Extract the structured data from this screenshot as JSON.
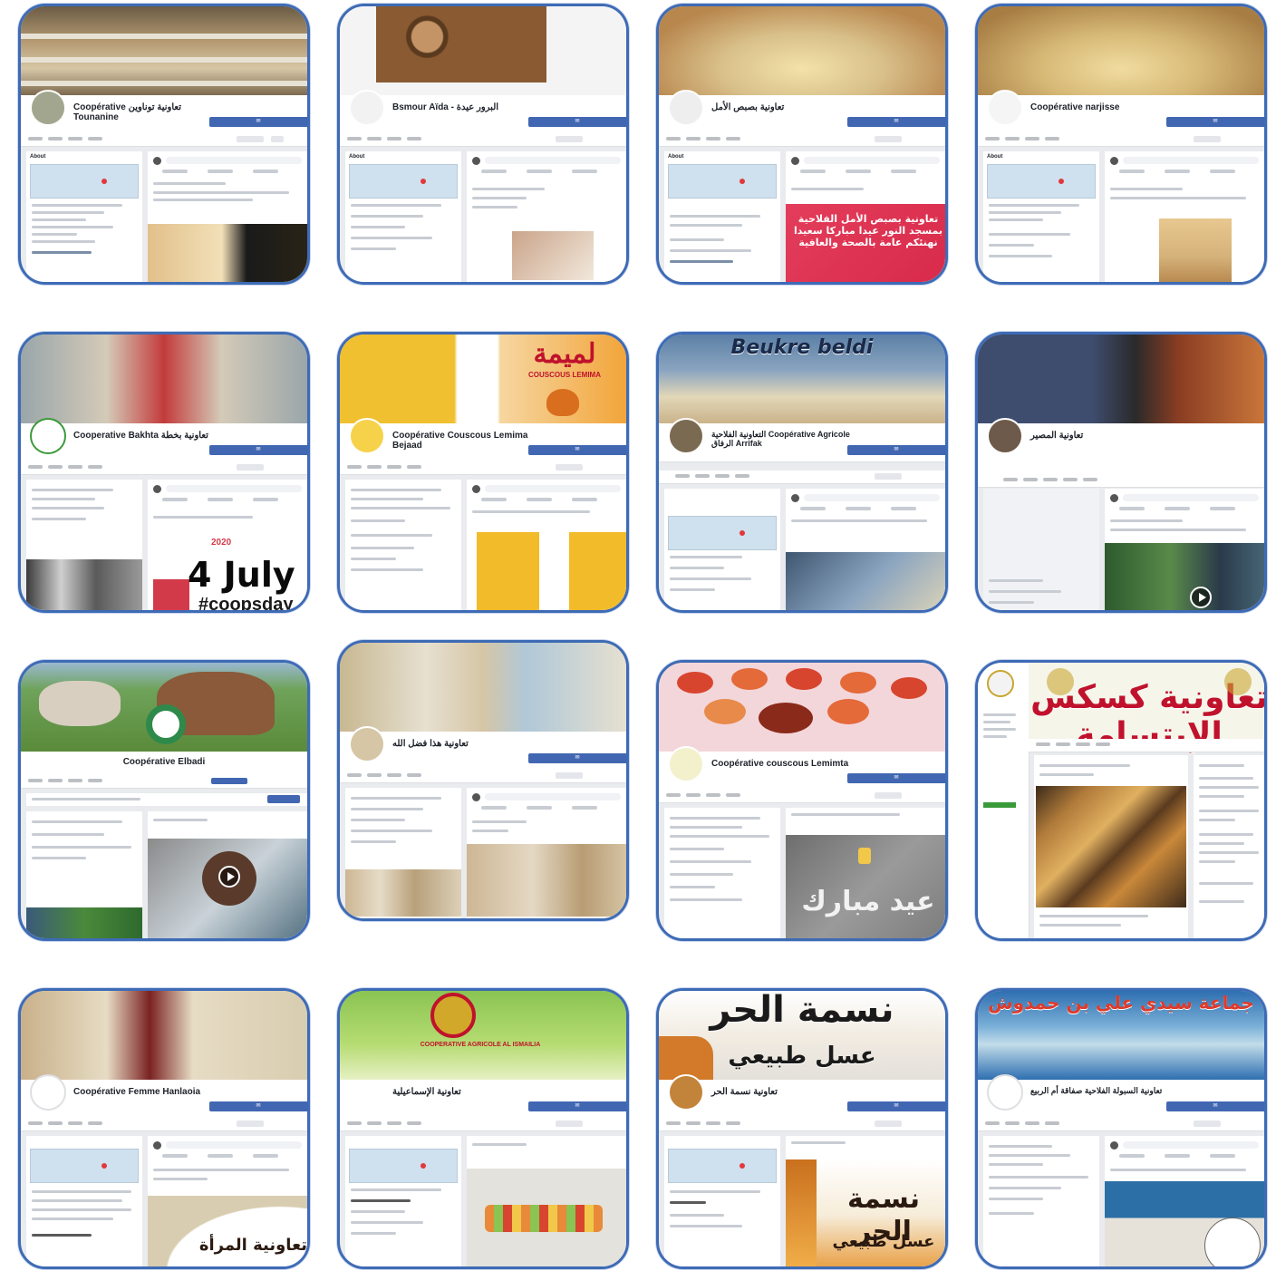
{
  "cards": [
    {
      "id": "c1",
      "name": "Coopérative تعاونية توناوين Tounanine",
      "sub": "",
      "button": "",
      "cover": "#b59a73",
      "cover2": "#7d6a4f",
      "avatar": "#a2a68e",
      "post": "#e2c08a",
      "caption": ""
    },
    {
      "id": "c2",
      "name": "Bsmour Aïda - البرور عيدة",
      "sub": "",
      "button": "",
      "cover": "#8a5a32",
      "cover2": "#c49466",
      "avatar": "#f2f2f2",
      "post": "#caa48a",
      "caption": ""
    },
    {
      "id": "c3",
      "name": "تعاونية بصبص الأمل",
      "sub": "",
      "button": "",
      "cover": "#d9c08a",
      "cover2": "#b8874e",
      "avatar": "#eeeeee",
      "post": "#e33d5b",
      "caption": "تعاونية بصبص الأمل الفلاحية بمسجد النور عيدا مباركا سعيدا نهنئكم عامة بالصحة والعافية"
    },
    {
      "id": "c4",
      "name": "Coopérative narjisse",
      "sub": "",
      "button": "",
      "cover": "#d7b976",
      "cover2": "#a77d44",
      "avatar": "#f5f5f5",
      "post": "#d5b27a",
      "caption": ""
    },
    {
      "id": "c5",
      "name": "Cooperative Bakhta تعاونية بخطة",
      "sub": "",
      "button": "",
      "cover": "#9aa6aa",
      "cover2": "#c33b3b",
      "avatar": "#ffffff",
      "post": "#d23a4a",
      "caption": "4 July",
      "caption2": "2020",
      "caption3": "#coopsday"
    },
    {
      "id": "c6",
      "name": "Coopérative Couscous Lemima Bejaad",
      "sub": "",
      "button": "",
      "cover": "#f0c030",
      "cover2": "#d86e1e",
      "avatar": "#f6d24a",
      "post": "#f2bb2a",
      "caption": "COUSCOUS LEMIMA",
      "caption_ar": "لميمة"
    },
    {
      "id": "c7",
      "name": "التعاونية الفلاحية Coopérative Agricole الرفاق Arrifak",
      "sub": "",
      "button": "",
      "cover": "#5b80a6",
      "cover2": "#e2d7b8",
      "avatar": "#7b6a52",
      "post": "#3f5670",
      "caption": "Beukre beldi"
    },
    {
      "id": "c8",
      "name": "تعاونية المصير",
      "sub": "",
      "button": "",
      "cover": "#3e4c6e",
      "cover2": "#8a3d22",
      "avatar": "#6e5a4a",
      "post": "#2e5a2e",
      "caption": ""
    },
    {
      "id": "c9",
      "name": "Coopérative Elbadi",
      "sub": "",
      "button": "",
      "cover": "#6fa35a",
      "cover2": "#8a5a3a",
      "avatar": "#2e8a4a",
      "post": "#4b6a7a",
      "caption": ""
    },
    {
      "id": "c10",
      "name": "تعاونية هذا فضل الله",
      "sub": "",
      "button": "",
      "cover": "#c8b892",
      "cover2": "#e6e0d0",
      "avatar": "#d6c6a6",
      "post": "#cdb694",
      "caption": ""
    },
    {
      "id": "c11",
      "name": "Coopérative couscous Lemimta",
      "sub": "",
      "button": "",
      "cover": "#f3d6da",
      "cover2": "#d8452e",
      "avatar": "#f3f0cc",
      "post": "#8e8e8e",
      "caption": "عيد مبارك"
    },
    {
      "id": "c12",
      "name": "تعاونية كسكس الإبتسامة",
      "sub": "",
      "button": "",
      "cover": "#f5f5ea",
      "cover2": "#3a9a3a",
      "avatar": "#f3f3f3",
      "post": "#b07a3a",
      "caption": "تعاونية كسكس الإبتسامة"
    },
    {
      "id": "c13",
      "name": "Coopérative Femme Hanlaoia",
      "sub": "",
      "button": "",
      "cover": "#e6dcc4",
      "cover2": "#7a2222",
      "avatar": "#ffffff",
      "post": "#d8cdb0",
      "caption": "تعاونية المرأة"
    },
    {
      "id": "c14",
      "name": "تعاونية الإسماعيلية",
      "sub": "",
      "button": "",
      "cover": "#8ac452",
      "cover2": "#d2a82a",
      "avatar": "#ffffff",
      "post": "#e4e2dc",
      "caption": "COOPERATIVE AGRICOLE AL ISMAILIA"
    },
    {
      "id": "c15",
      "name": "تعاونية نسمة الحر",
      "sub": "",
      "button": "",
      "cover": "#f2ece2",
      "cover2": "#d27a2a",
      "avatar": "#c2843a",
      "post": "#e79a3a",
      "caption": "نسمة الحر",
      "caption2": "عسل طبيعي"
    },
    {
      "id": "c16",
      "name": "تعاونية السبولة الفلاحية صفاقة أم الربيع",
      "sub": "",
      "button": "",
      "cover": "#2e6fb0",
      "cover2": "#e03a2a",
      "avatar": "#ffffff",
      "post": "#2b6fa6",
      "caption": "جماعة سيدي علي بن حمدوش"
    }
  ]
}
